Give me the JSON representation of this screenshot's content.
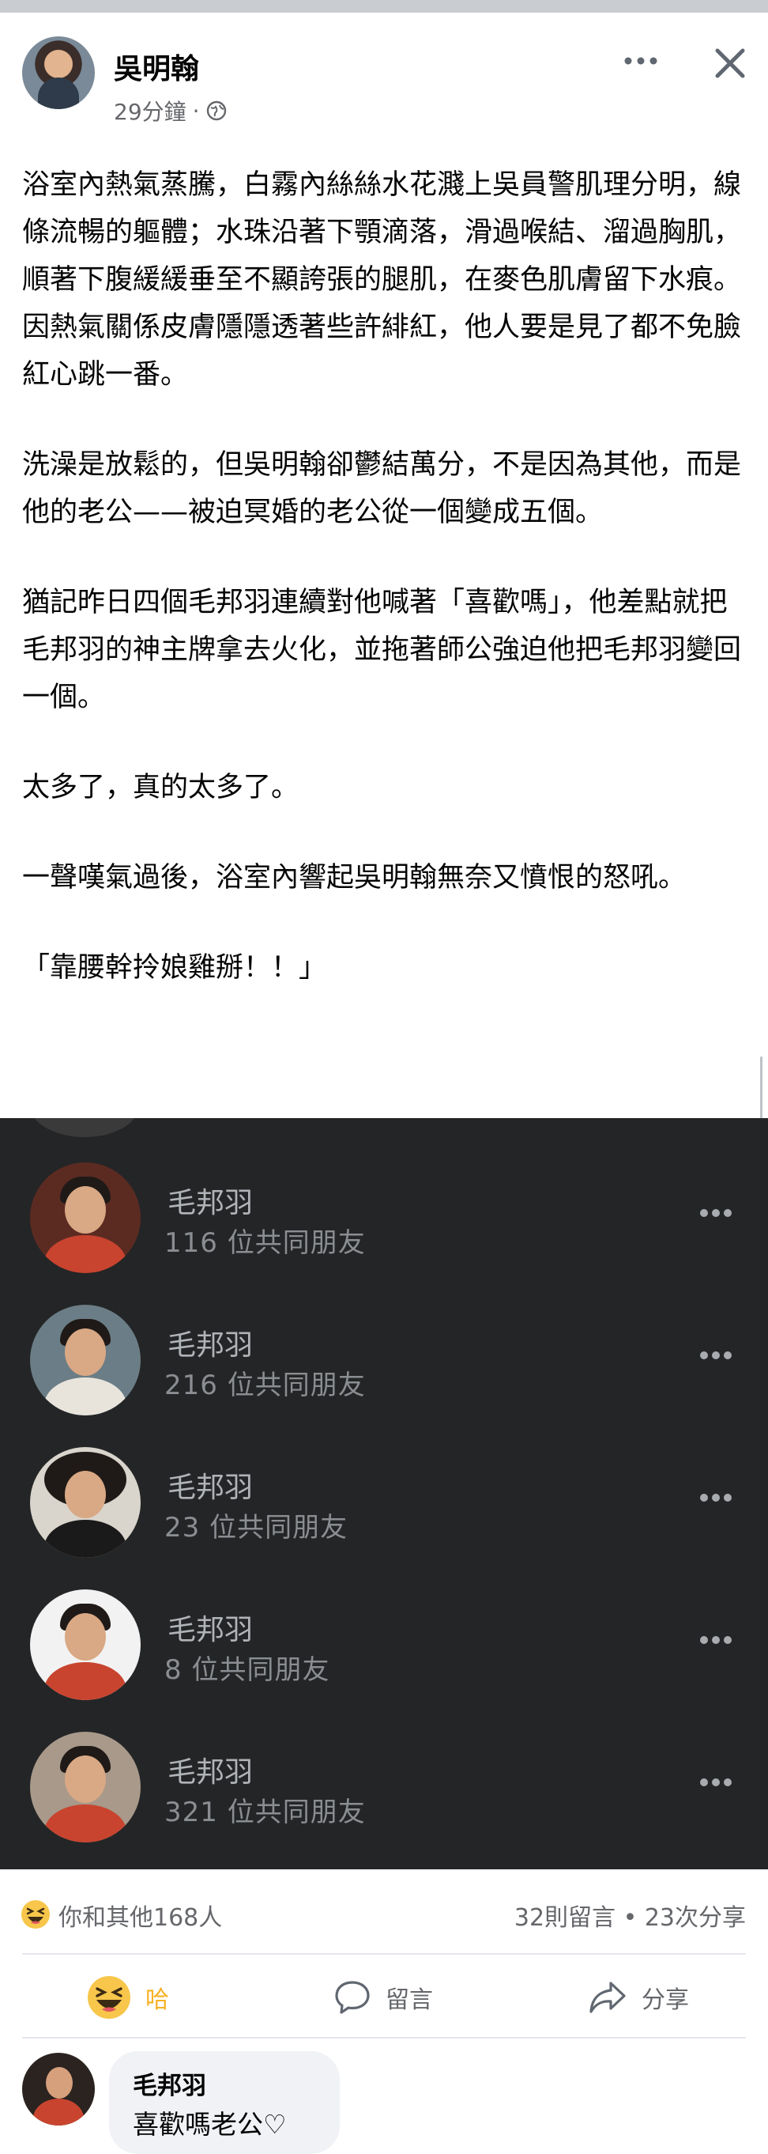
{
  "post": {
    "author": "吳明翰",
    "time": "29分鐘",
    "separator": "·",
    "paragraphs": [
      "浴室內熱氣蒸騰，白霧內絲絲水花濺上吳員警肌理分明，線條流暢的軀體；水珠沿著下顎滴落，滑過喉結、溜過胸肌，順著下腹緩緩垂至不顯誇張的腿肌，在麥色肌膚留下水痕。因熱氣關係皮膚隱隱透著些許緋紅，他人要是見了都不免臉紅心跳一番。",
      "洗澡是放鬆的，但吳明翰卻鬱結萬分，不是因為其他，而是他的老公——被迫冥婚的老公從一個變成五個。",
      "猶記昨日四個毛邦羽連續對他喊著「喜歡嗎」，他差點就把毛邦羽的神主牌拿去火化，並拖著師公強迫他把毛邦羽變回一個。",
      "太多了，真的太多了。",
      "一聲嘆氣過後，浴室內響起吳明翰無奈又憤恨的怒吼。",
      "「靠腰幹拎娘雞掰！！」"
    ]
  },
  "friends": [
    {
      "name": "毛邦羽",
      "mutual": "116 位共同朋友",
      "bg": "#5b2b22"
    },
    {
      "name": "毛邦羽",
      "mutual": "216 位共同朋友",
      "bg": "#6b7d86"
    },
    {
      "name": "毛邦羽",
      "mutual": "23 位共同朋友",
      "bg": "#d9d4cc"
    },
    {
      "name": "毛邦羽",
      "mutual": "8 位共同朋友",
      "bg": "#f2f2f2"
    },
    {
      "name": "毛邦羽",
      "mutual": "321 位共同朋友",
      "bg": "#a8998a"
    }
  ],
  "summary": {
    "reactions": "你和其他168人",
    "stats": "32則留言 • 23次分享"
  },
  "actions": {
    "haha": "哈",
    "comment": "留言",
    "share": "分享"
  },
  "comment": {
    "author": "毛邦羽",
    "text": "喜歡嗎老公♡"
  },
  "colors": {
    "dark_panel": "#242526",
    "haha_accent": "#f7b125",
    "muted_text": "#65676b"
  }
}
